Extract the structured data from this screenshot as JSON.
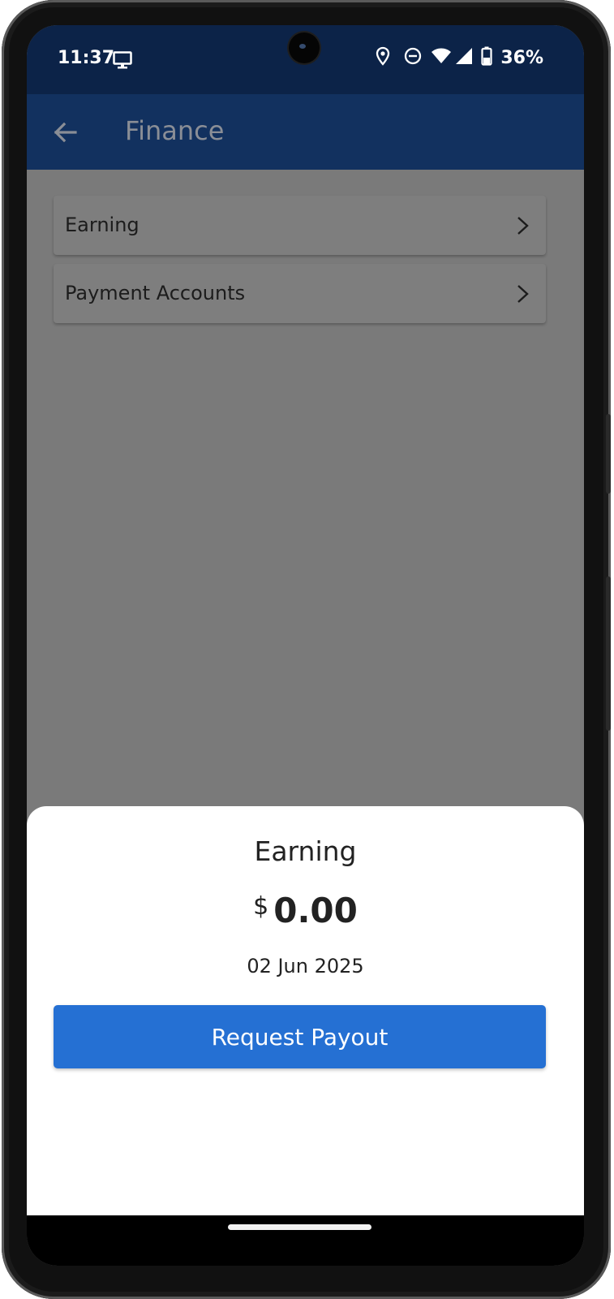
{
  "status_bar": {
    "time": "11:37",
    "battery_percent": "36%",
    "icons": [
      "monitor-icon",
      "location-icon",
      "do-not-disturb-icon",
      "wifi-icon",
      "signal-icon",
      "battery-icon"
    ]
  },
  "app_bar": {
    "title": "Finance",
    "back_icon": "arrow-left-icon"
  },
  "menu": {
    "items": [
      {
        "label": "Earning",
        "icon": "chevron-right-icon"
      },
      {
        "label": "Payment Accounts",
        "icon": "chevron-right-icon"
      }
    ]
  },
  "sheet": {
    "title": "Earning",
    "currency": "$",
    "amount": "0.00",
    "date": "02 Jun 2025",
    "button_label": "Request Payout"
  },
  "colors": {
    "status_bar": "#0c2348",
    "app_bar": "#12315f",
    "scrim_background": "#7a7a7a",
    "primary_button": "#2570d3"
  }
}
